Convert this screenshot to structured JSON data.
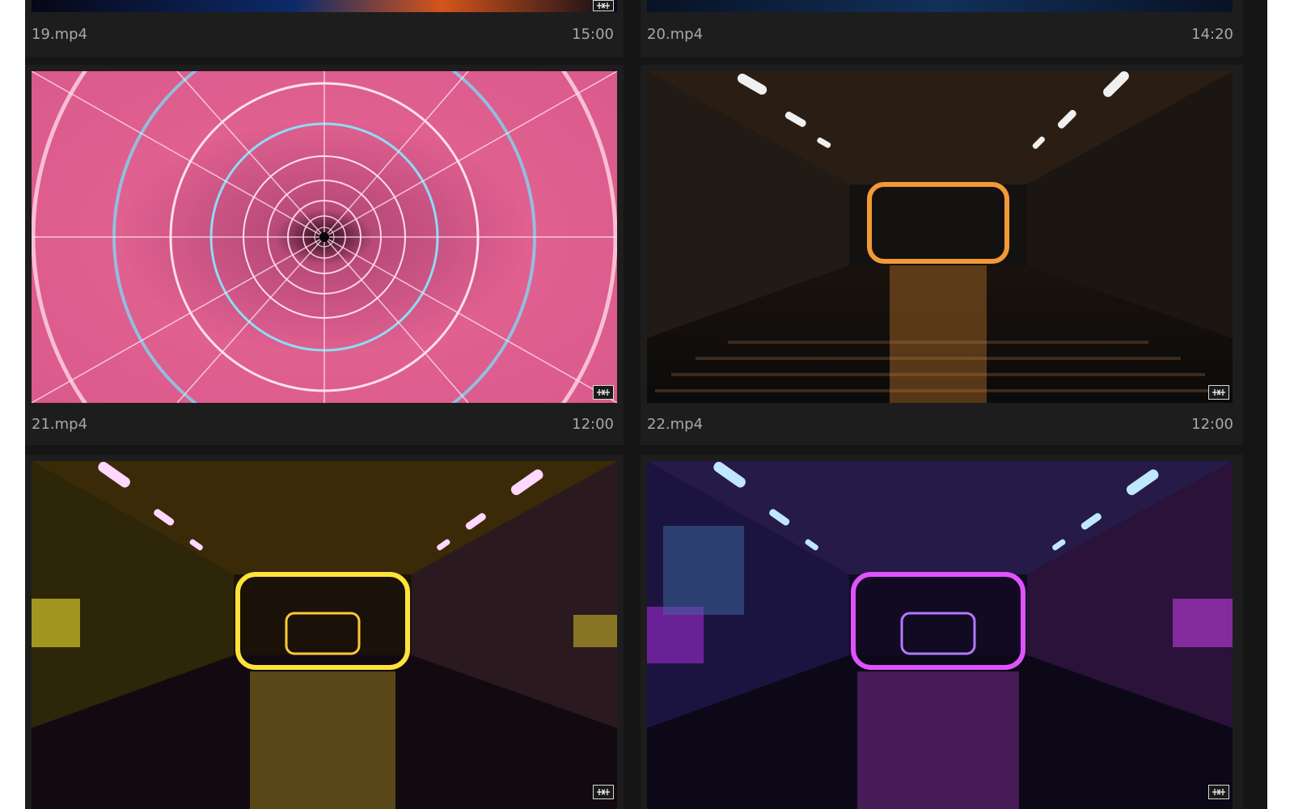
{
  "media_bin": {
    "clips": [
      {
        "name": "19.mp4",
        "duration": "15:00",
        "icon": "clip-media-icon"
      },
      {
        "name": "20.mp4",
        "duration": "14:20",
        "icon": "clip-media-icon"
      },
      {
        "name": "21.mp4",
        "duration": "12:00",
        "icon": "clip-media-icon"
      },
      {
        "name": "22.mp4",
        "duration": "12:00",
        "icon": "clip-media-icon"
      },
      {
        "name": "",
        "duration": "",
        "icon": "clip-media-icon"
      },
      {
        "name": "",
        "duration": "",
        "icon": "clip-media-icon"
      }
    ]
  },
  "colors": {
    "panel_bg": "#151515",
    "cell_bg": "#1d1d1d",
    "text": "#a7a7a7"
  }
}
